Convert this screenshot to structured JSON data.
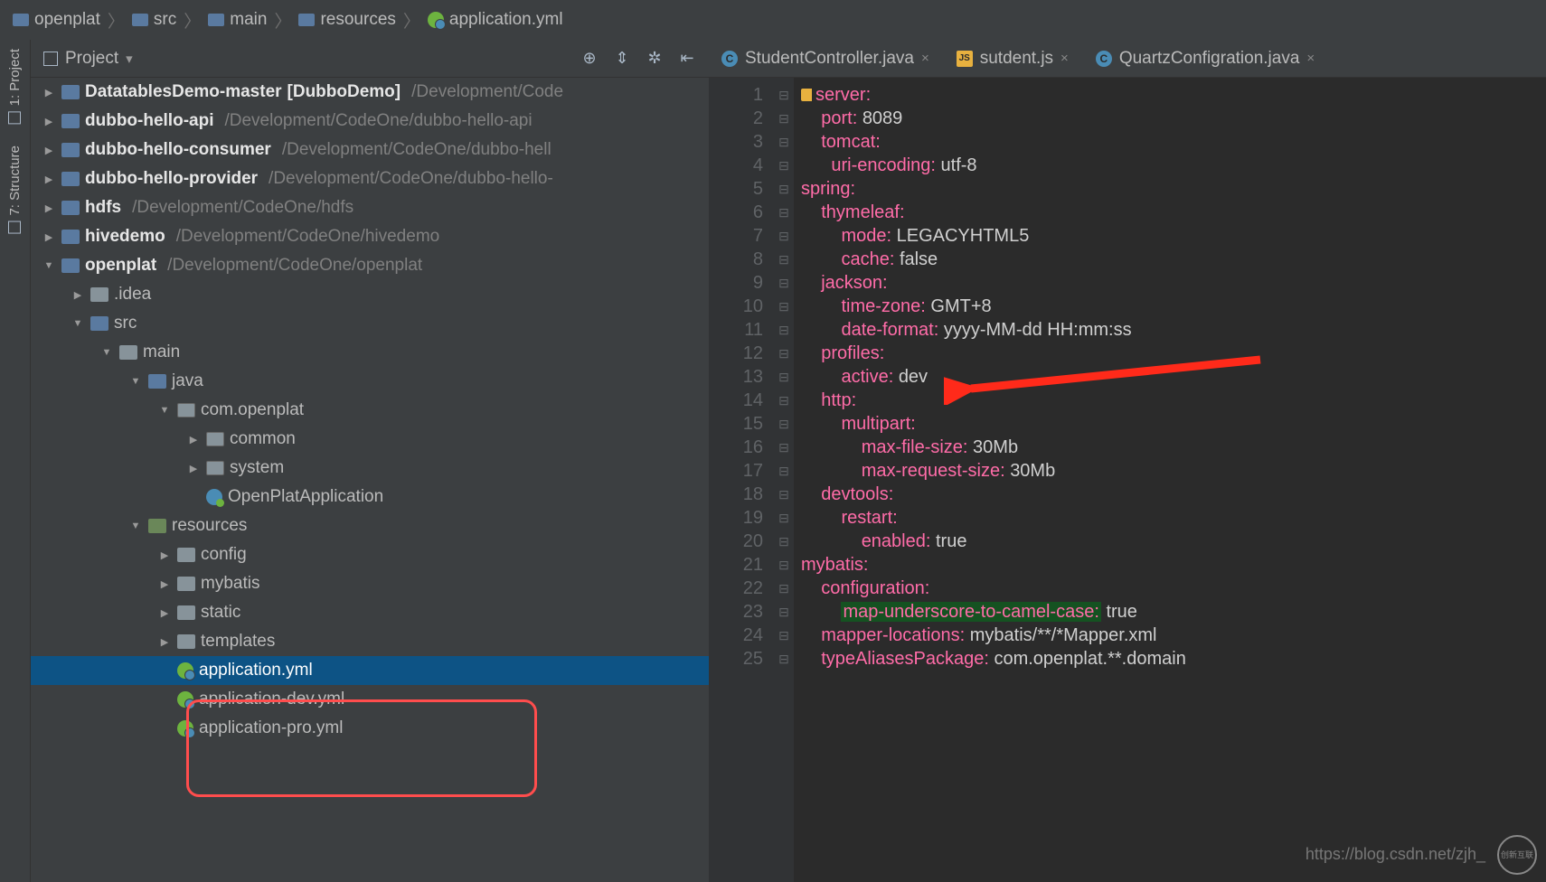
{
  "breadcrumbs": [
    "openplat",
    "src",
    "main",
    "resources",
    "application.yml"
  ],
  "project_panel": {
    "title": "Project"
  },
  "toolwindows": {
    "project": "1: Project",
    "structure": "7: Structure"
  },
  "tree": [
    {
      "depth": 0,
      "exp": true,
      "icon": "folder-blue",
      "name": "DatatablesDemo-master",
      "bold": true,
      "bracket": "[DubboDemo]",
      "path": "/Development/Code"
    },
    {
      "depth": 0,
      "exp": true,
      "icon": "folder-blue",
      "name": "dubbo-hello-api",
      "bold": true,
      "path": "/Development/CodeOne/dubbo-hello-api"
    },
    {
      "depth": 0,
      "exp": true,
      "icon": "folder-blue",
      "name": "dubbo-hello-consumer",
      "bold": true,
      "path": "/Development/CodeOne/dubbo-hell"
    },
    {
      "depth": 0,
      "exp": true,
      "icon": "folder-blue",
      "name": "dubbo-hello-provider",
      "bold": true,
      "path": "/Development/CodeOne/dubbo-hello-"
    },
    {
      "depth": 0,
      "exp": true,
      "icon": "folder-blue",
      "name": "hdfs",
      "bold": true,
      "path": "/Development/CodeOne/hdfs"
    },
    {
      "depth": 0,
      "exp": true,
      "icon": "folder-blue",
      "name": "hivedemo",
      "bold": true,
      "path": "/Development/CodeOne/hivedemo"
    },
    {
      "depth": 0,
      "exp": true,
      "expanded": true,
      "icon": "folder-blue",
      "name": "openplat",
      "bold": true,
      "path": "/Development/CodeOne/openplat"
    },
    {
      "depth": 1,
      "icon": "folder",
      "name": ".idea"
    },
    {
      "depth": 1,
      "expanded": true,
      "icon": "folder-src",
      "name": "src"
    },
    {
      "depth": 2,
      "expanded": true,
      "icon": "folder",
      "name": "main"
    },
    {
      "depth": 3,
      "expanded": true,
      "icon": "folder-blue",
      "name": "java"
    },
    {
      "depth": 4,
      "expanded": true,
      "icon": "package",
      "name": "com.openplat"
    },
    {
      "depth": 5,
      "icon": "package",
      "name": "common"
    },
    {
      "depth": 5,
      "icon": "package",
      "name": "system"
    },
    {
      "depth": 5,
      "leaf": true,
      "icon": "class-icon",
      "name": "OpenPlatApplication"
    },
    {
      "depth": 3,
      "expanded": true,
      "icon": "folder-res",
      "name": "resources"
    },
    {
      "depth": 4,
      "icon": "folder",
      "name": "config"
    },
    {
      "depth": 4,
      "icon": "folder",
      "name": "mybatis"
    },
    {
      "depth": 4,
      "icon": "folder",
      "name": "static"
    },
    {
      "depth": 4,
      "icon": "folder",
      "name": "templates"
    },
    {
      "depth": 4,
      "leaf": true,
      "icon": "spring",
      "name": "application.yml",
      "selected": true
    },
    {
      "depth": 4,
      "leaf": true,
      "icon": "spring",
      "name": "application-dev.yml"
    },
    {
      "depth": 4,
      "leaf": true,
      "icon": "spring",
      "name": "application-pro.yml"
    }
  ],
  "tabs": [
    {
      "type": "java",
      "icon": "C",
      "label": "StudentController.java"
    },
    {
      "type": "js",
      "icon": "JS",
      "label": "sutdent.js"
    },
    {
      "type": "java",
      "icon": "C",
      "label": "QuartzConfigration.java"
    }
  ],
  "code": [
    {
      "n": 1,
      "mark": true,
      "tokens": [
        [
          "key",
          "server:"
        ]
      ]
    },
    {
      "n": 2,
      "tokens": [
        [
          "plain",
          "    "
        ],
        [
          "key",
          "port: "
        ],
        [
          "plain",
          "8089"
        ]
      ]
    },
    {
      "n": 3,
      "tokens": [
        [
          "plain",
          "    "
        ],
        [
          "key",
          "tomcat:"
        ]
      ]
    },
    {
      "n": 4,
      "tokens": [
        [
          "plain",
          "      "
        ],
        [
          "key",
          "uri-encoding: "
        ],
        [
          "plain",
          "utf-8"
        ]
      ]
    },
    {
      "n": 5,
      "tokens": [
        [
          "key",
          "spring:"
        ]
      ]
    },
    {
      "n": 6,
      "tokens": [
        [
          "plain",
          "    "
        ],
        [
          "key",
          "thymeleaf:"
        ]
      ]
    },
    {
      "n": 7,
      "tokens": [
        [
          "plain",
          "        "
        ],
        [
          "key",
          "mode: "
        ],
        [
          "plain",
          "LEGACYHTML5"
        ]
      ]
    },
    {
      "n": 8,
      "tokens": [
        [
          "plain",
          "        "
        ],
        [
          "key",
          "cache: "
        ],
        [
          "plain",
          "false"
        ]
      ]
    },
    {
      "n": 9,
      "tokens": [
        [
          "plain",
          "    "
        ],
        [
          "key",
          "jackson:"
        ]
      ]
    },
    {
      "n": 10,
      "tokens": [
        [
          "plain",
          "        "
        ],
        [
          "key",
          "time-zone: "
        ],
        [
          "plain",
          "GMT+8"
        ]
      ]
    },
    {
      "n": 11,
      "tokens": [
        [
          "plain",
          "        "
        ],
        [
          "key",
          "date-format: "
        ],
        [
          "plain",
          "yyyy-MM-dd HH:mm:ss"
        ]
      ]
    },
    {
      "n": 12,
      "tokens": [
        [
          "plain",
          "    "
        ],
        [
          "key",
          "profiles:"
        ]
      ]
    },
    {
      "n": 13,
      "tokens": [
        [
          "plain",
          "        "
        ],
        [
          "key",
          "active: "
        ],
        [
          "plain",
          "dev"
        ]
      ]
    },
    {
      "n": 14,
      "tokens": [
        [
          "plain",
          "    "
        ],
        [
          "key",
          "http:"
        ]
      ]
    },
    {
      "n": 15,
      "tokens": [
        [
          "plain",
          "        "
        ],
        [
          "key",
          "multipart:"
        ]
      ]
    },
    {
      "n": 16,
      "tokens": [
        [
          "plain",
          "            "
        ],
        [
          "key",
          "max-file-size: "
        ],
        [
          "plain",
          "30Mb"
        ]
      ]
    },
    {
      "n": 17,
      "tokens": [
        [
          "plain",
          "            "
        ],
        [
          "key",
          "max-request-size: "
        ],
        [
          "plain",
          "30Mb"
        ]
      ]
    },
    {
      "n": 18,
      "tokens": [
        [
          "plain",
          "    "
        ],
        [
          "key",
          "devtools:"
        ]
      ]
    },
    {
      "n": 19,
      "tokens": [
        [
          "plain",
          "        "
        ],
        [
          "key",
          "restart:"
        ]
      ]
    },
    {
      "n": 20,
      "tokens": [
        [
          "plain",
          "            "
        ],
        [
          "key",
          "enabled: "
        ],
        [
          "plain",
          "true"
        ]
      ]
    },
    {
      "n": 21,
      "tokens": [
        [
          "key",
          "mybatis:"
        ]
      ]
    },
    {
      "n": 22,
      "tokens": [
        [
          "plain",
          "    "
        ],
        [
          "key",
          "configuration:"
        ]
      ]
    },
    {
      "n": 23,
      "tokens": [
        [
          "plain",
          "        "
        ],
        [
          "keyhi",
          "map-underscore-to-camel-case:"
        ],
        [
          "plain",
          " true"
        ]
      ]
    },
    {
      "n": 24,
      "tokens": [
        [
          "plain",
          "    "
        ],
        [
          "key",
          "mapper-locations: "
        ],
        [
          "plain",
          "mybatis/**/*Mapper.xml"
        ]
      ]
    },
    {
      "n": 25,
      "tokens": [
        [
          "plain",
          "    "
        ],
        [
          "key",
          "typeAliasesPackage: "
        ],
        [
          "plain",
          "com.openplat.**.domain"
        ]
      ]
    }
  ],
  "watermark": {
    "url": "https://blog.csdn.net/zjh_",
    "logo": "创新互联"
  }
}
